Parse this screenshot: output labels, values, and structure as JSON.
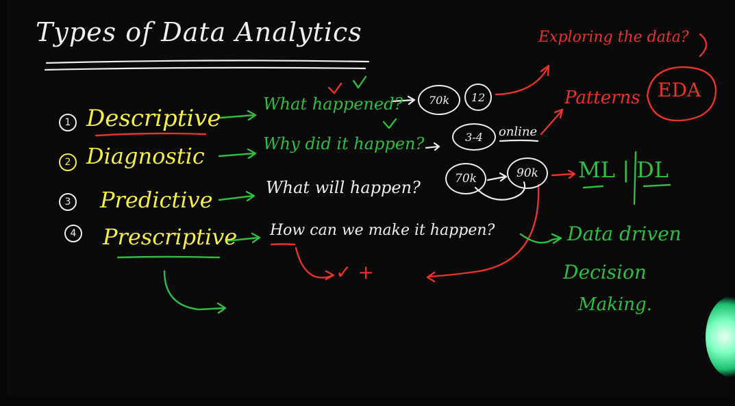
{
  "title": "Types of Data Analytics",
  "items": [
    {
      "number": "1",
      "type": "Descriptive",
      "question": "What happened?"
    },
    {
      "number": "2",
      "type": "Diagnostic",
      "question": "Why did it happen?"
    },
    {
      "number": "3",
      "type": "Predictive",
      "question": "What will happen?"
    },
    {
      "number": "4",
      "type": "Prescriptive",
      "question": "How can we make it happen?"
    }
  ],
  "annotations": {
    "descriptive_circle_1": "70k",
    "descriptive_circle_2": "12",
    "diagnostic_circle": "3-4",
    "diagnostic_note": "online",
    "predictive_circle_1": "70k",
    "predictive_circle_2": "90k",
    "exploring": "Exploring the data?",
    "patterns": "Patterns",
    "eda": "EDA",
    "ml_dl": "ML | DL",
    "data_driven": "Data driven",
    "decision": "Decision",
    "making": "Making.",
    "check_plus": "✓ +"
  },
  "colors": {
    "background": "#0a0a0a",
    "white_ink": "#eeeeee",
    "yellow_ink": "#f4ef45",
    "green_ink": "#2fbd43",
    "red_ink": "#e8322c"
  }
}
